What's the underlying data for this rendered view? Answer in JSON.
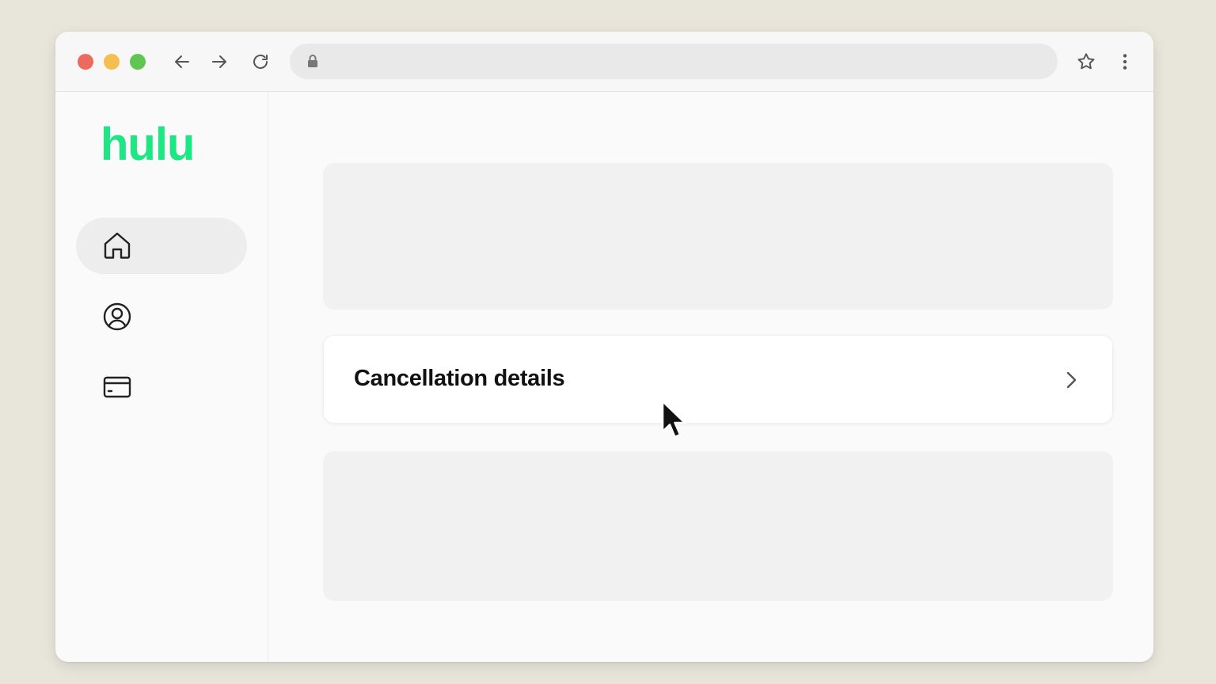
{
  "browser": {
    "url": "",
    "controls": {
      "close": "close-dot",
      "minimize": "minimize-dot",
      "maximize": "maximize-dot",
      "back": "arrow-left-icon",
      "forward": "arrow-right-icon",
      "reload": "reload-icon",
      "lock": "lock-icon",
      "bookmark": "star-icon",
      "menu": "kebab-menu-icon"
    }
  },
  "brand": {
    "logo_text": "hulu",
    "logo_color": "#1ce783"
  },
  "sidebar": {
    "items": [
      {
        "name": "home",
        "icon": "home-icon",
        "active": true
      },
      {
        "name": "account",
        "icon": "user-circle-icon",
        "active": false
      },
      {
        "name": "billing",
        "icon": "credit-card-icon",
        "active": false
      }
    ]
  },
  "main": {
    "card": {
      "title": "Cancellation details",
      "icon": "chevron-right-icon"
    }
  },
  "colors": {
    "background": "#e8e5da",
    "window": "#fafafa",
    "placeholder": "#f1f1f1",
    "active_item": "#ededed"
  }
}
